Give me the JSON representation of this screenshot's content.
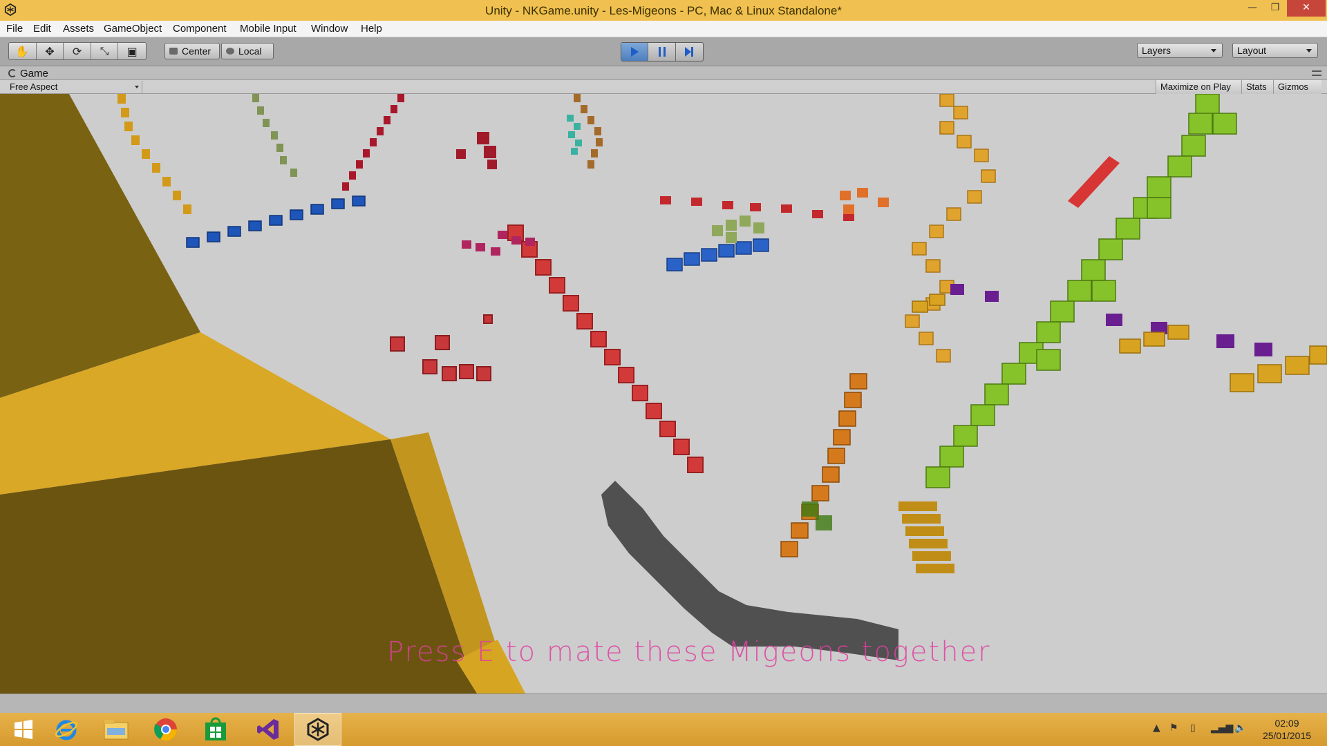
{
  "window": {
    "title": "Unity - NKGame.unity - Les-Migeons - PC, Mac & Linux Standalone*",
    "minimize": "—",
    "maximize": "❐",
    "close": "✕"
  },
  "menu": [
    "File",
    "Edit",
    "Assets",
    "GameObject",
    "Component",
    "Mobile Input",
    "Window",
    "Help"
  ],
  "toolbar": {
    "tools": [
      "hand-icon",
      "move-icon",
      "rotate-icon",
      "scale-icon",
      "rect-icon"
    ],
    "pivot_mode": "Center",
    "pivot_rotation": "Local",
    "layers": "Layers",
    "layout": "Layout",
    "play_active": true
  },
  "game_view": {
    "tab_label": "Game",
    "aspect": "Free Aspect",
    "maximize_on_play": "Maximize on Play",
    "stats": "Stats",
    "gizmos": "Gizmos",
    "overlay_message": "Press E to mate these Migeons together"
  },
  "taskbar": {
    "apps": [
      "windows-start-icon",
      "internet-explorer-icon",
      "file-explorer-icon",
      "chrome-icon",
      "store-icon",
      "visual-studio-icon",
      "unity-icon"
    ],
    "active_app": "unity-icon",
    "clock_time": "02:09",
    "clock_date": "25/01/2015"
  }
}
